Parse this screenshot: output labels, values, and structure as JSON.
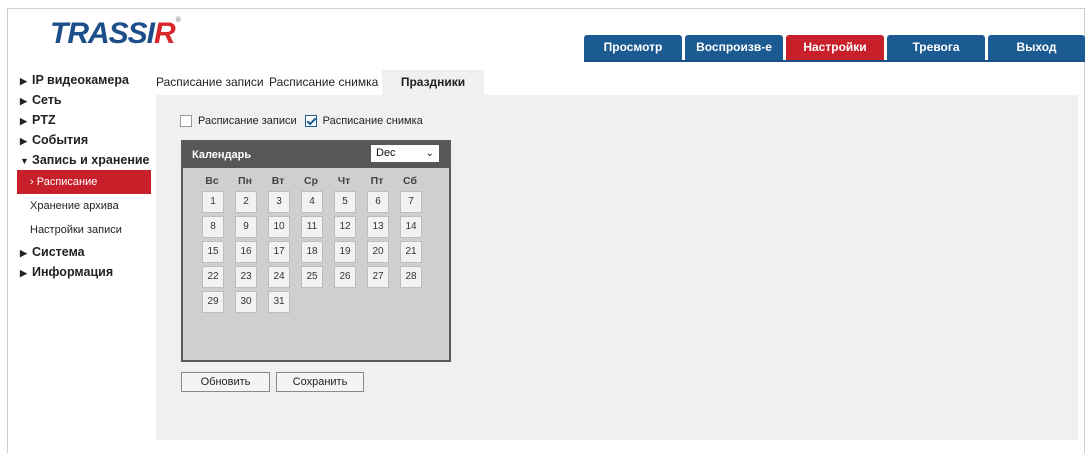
{
  "logo": {
    "main": "TRASSI",
    "accent": "R",
    "reg": "®"
  },
  "nav": [
    {
      "label": "Просмотр"
    },
    {
      "label": "Воспроизв-е"
    },
    {
      "label": "Настройки",
      "active": true
    },
    {
      "label": "Тревога"
    },
    {
      "label": "Выход"
    }
  ],
  "sidebar": {
    "ip_camera": "IP видеокамера",
    "network": "Сеть",
    "ptz": "PTZ",
    "events": "События",
    "record_storage": "Запись и хранение",
    "schedule": "Расписание",
    "archive_storage": "Хранение архива",
    "record_settings": "Настройки записи",
    "system": "Система",
    "info": "Информация"
  },
  "tabs": {
    "record_schedule": "Расписание записи",
    "snapshot_schedule": "Расписание снимка",
    "holidays": "Праздники"
  },
  "checks": {
    "record_schedule": {
      "label": "Расписание записи",
      "checked": false
    },
    "snapshot_schedule": {
      "label": "Расписание снимка",
      "checked": true
    }
  },
  "calendar": {
    "title": "Календарь",
    "month": "Dec",
    "weekdays": [
      "Вс",
      "Пн",
      "Вт",
      "Ср",
      "Чт",
      "Пт",
      "Сб"
    ],
    "days": [
      "1",
      "2",
      "3",
      "4",
      "5",
      "6",
      "7",
      "8",
      "9",
      "10",
      "11",
      "12",
      "13",
      "14",
      "15",
      "16",
      "17",
      "18",
      "19",
      "20",
      "21",
      "22",
      "23",
      "24",
      "25",
      "26",
      "27",
      "28",
      "29",
      "30",
      "31"
    ]
  },
  "buttons": {
    "refresh": "Обновить",
    "save": "Сохранить"
  },
  "colors": {
    "brand_blue": "#1c5a92",
    "active_red": "#c8202a"
  }
}
